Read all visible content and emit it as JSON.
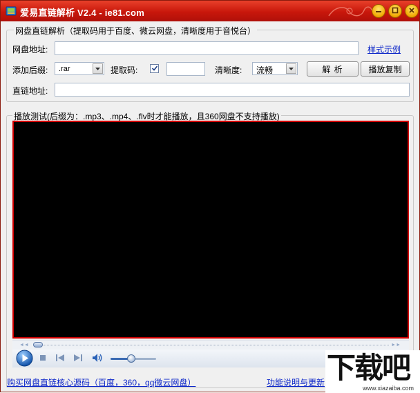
{
  "window": {
    "title": "爱易直链解析 V2.4 - ie81.com"
  },
  "parse_group": {
    "legend": "网盘直链解析（提取码用于百度、微云网盘，清晰度用于音悦台）",
    "disk_url_label": "网盘地址:",
    "disk_url_value": "",
    "style_example_link": "样式示例",
    "suffix_label": "添加后缀:",
    "suffix_value": ".rar",
    "extract_code_label": "提取码:",
    "extract_code_checked": true,
    "extract_code_value": "",
    "clarity_label": "清晰度:",
    "clarity_value": "流畅",
    "parse_button": "解 析",
    "play_copy_button": "播放复制",
    "direct_url_label": "直链地址:",
    "direct_url_value": ""
  },
  "player_group": {
    "legend": "播放测试(后缀为：.mp3、.mp4、.flv时才能播放，且360网盘不支持播放)",
    "seek_progress": 0.0,
    "volume_level": 0.45
  },
  "footer": {
    "buy_source_link": "购买网盘直链核心源码（百度，360，qq微云网盘）",
    "help_link": "功能说明与更新"
  },
  "watermark": {
    "brand": "下载吧",
    "site": "www.xiazaiba.com"
  },
  "colors": {
    "titlebar": "#c8170b",
    "video_border": "#d10000",
    "link": "#0a24c8"
  }
}
